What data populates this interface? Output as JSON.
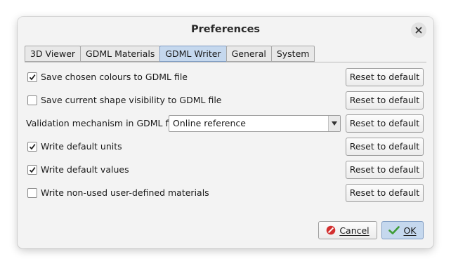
{
  "window": {
    "title": "Preferences",
    "close_icon": "close-icon"
  },
  "tabs": [
    {
      "label": "3D Viewer",
      "active": false
    },
    {
      "label": "GDML Materials",
      "active": false
    },
    {
      "label": "GDML Writer",
      "active": true
    },
    {
      "label": "General",
      "active": false
    },
    {
      "label": "System",
      "active": false
    }
  ],
  "settings": {
    "save_colours": {
      "label": "Save chosen colours to GDML file",
      "checked": true,
      "reset_label": "Reset to default"
    },
    "save_visibility": {
      "label": "Save current shape visibility to GDML file",
      "checked": false,
      "reset_label": "Reset to default"
    },
    "validation": {
      "label": "Validation mechanism in GDML file",
      "value": "Online reference",
      "reset_label": "Reset to default"
    },
    "default_units": {
      "label": "Write default units",
      "checked": true,
      "reset_label": "Reset to default"
    },
    "default_values": {
      "label": "Write default values",
      "checked": true,
      "reset_label": "Reset to default"
    },
    "non_used_materials": {
      "label": "Write non-used user-defined materials",
      "checked": false,
      "reset_label": "Reset to default"
    }
  },
  "buttons": {
    "cancel_label": "Cancel",
    "ok_label": "OK",
    "cancel_icon": "cancel-icon",
    "ok_icon": "checkmark-icon"
  },
  "colors": {
    "active_tab": "#c5d8ee",
    "cancel_icon": "#d32f2f",
    "ok_icon": "#3e9c35"
  }
}
